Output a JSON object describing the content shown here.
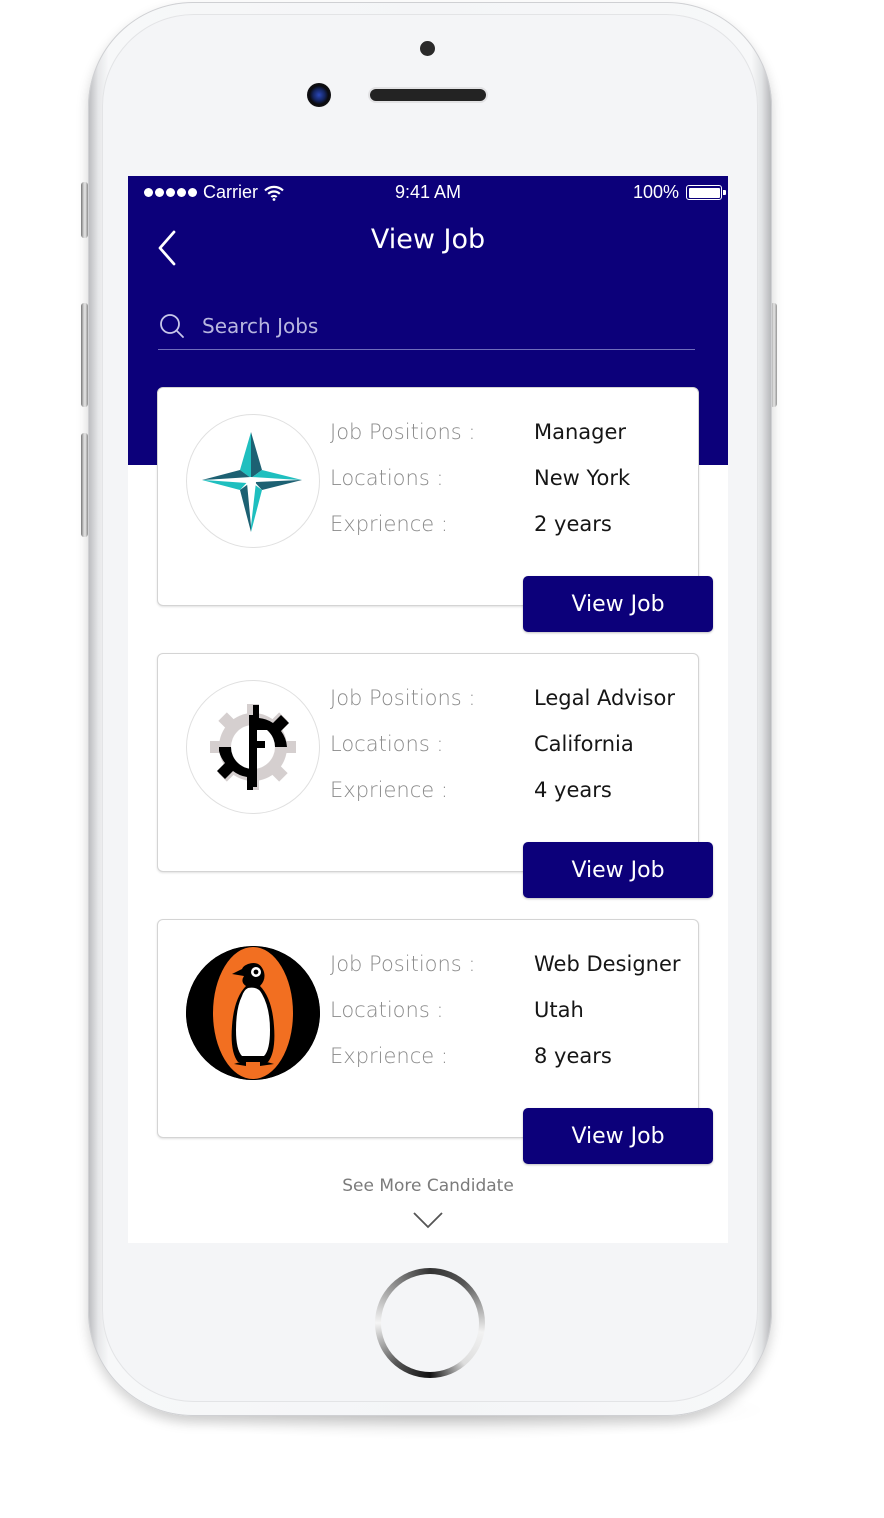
{
  "status_bar": {
    "carrier": "Carrier",
    "time": "9:41 AM",
    "battery": "100%"
  },
  "header": {
    "title": "View Job",
    "back_icon": "chevron-left-icon"
  },
  "search": {
    "placeholder": "Search Jobs",
    "value": "",
    "icon": "search-icon"
  },
  "labels": {
    "position": "Job Positions :",
    "location": "Locations :",
    "experience": "Exprience :"
  },
  "jobs": [
    {
      "logo": "teal-star-logo",
      "position": "Manager",
      "location": "New York",
      "experience": "2 years",
      "button": "View Job"
    },
    {
      "logo": "gear-f-logo",
      "position": "Legal Advisor",
      "location": "California",
      "experience": "4 years",
      "button": "View Job"
    },
    {
      "logo": "penguin-logo",
      "position": "Web Designer",
      "location": "Utah",
      "experience": "8 years",
      "button": "View Job"
    }
  ],
  "footer": {
    "see_more": "See More Candidate",
    "icon": "chevron-down-icon"
  },
  "colors": {
    "brand": "#0c007a",
    "teal": "#1fbfbf",
    "penguin_orange": "#f26f21"
  }
}
